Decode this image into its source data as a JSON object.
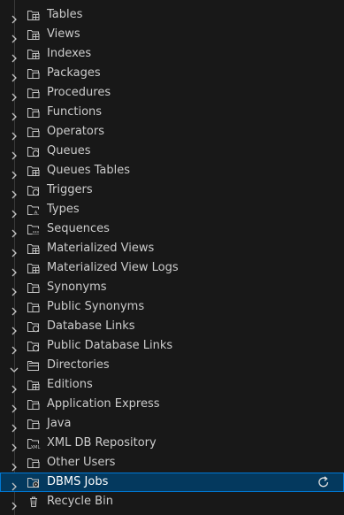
{
  "tree": {
    "items": [
      {
        "label": "Tables",
        "icon": "folder-tables-icon",
        "state": "collapsed"
      },
      {
        "label": "Views",
        "icon": "folder-views-icon",
        "state": "collapsed"
      },
      {
        "label": "Indexes",
        "icon": "folder-indexes-icon",
        "state": "collapsed"
      },
      {
        "label": "Packages",
        "icon": "folder-packages-icon",
        "state": "collapsed"
      },
      {
        "label": "Procedures",
        "icon": "folder-procedures-icon",
        "state": "collapsed"
      },
      {
        "label": "Functions",
        "icon": "folder-functions-icon",
        "state": "collapsed"
      },
      {
        "label": "Operators",
        "icon": "folder-operators-icon",
        "state": "collapsed"
      },
      {
        "label": "Queues",
        "icon": "folder-queues-icon",
        "state": "collapsed"
      },
      {
        "label": "Queues Tables",
        "icon": "folder-queues-tables-icon",
        "state": "collapsed"
      },
      {
        "label": "Triggers",
        "icon": "folder-triggers-icon",
        "state": "collapsed"
      },
      {
        "label": "Types",
        "icon": "folder-types-icon",
        "state": "collapsed"
      },
      {
        "label": "Sequences",
        "icon": "folder-sequences-icon",
        "state": "collapsed"
      },
      {
        "label": "Materialized Views",
        "icon": "folder-materialized-views-icon",
        "state": "collapsed"
      },
      {
        "label": "Materialized View Logs",
        "icon": "folder-materialized-view-logs-icon",
        "state": "collapsed"
      },
      {
        "label": "Synonyms",
        "icon": "folder-synonyms-icon",
        "state": "collapsed"
      },
      {
        "label": "Public Synonyms",
        "icon": "folder-public-synonyms-icon",
        "state": "collapsed"
      },
      {
        "label": "Database Links",
        "icon": "folder-database-links-icon",
        "state": "collapsed"
      },
      {
        "label": "Public Database Links",
        "icon": "folder-public-database-links-icon",
        "state": "collapsed"
      },
      {
        "label": "Directories",
        "icon": "folder-directories-icon",
        "state": "expanded"
      },
      {
        "label": "Editions",
        "icon": "folder-editions-icon",
        "state": "collapsed"
      },
      {
        "label": "Application Express",
        "icon": "folder-application-express-icon",
        "state": "collapsed"
      },
      {
        "label": "Java",
        "icon": "folder-java-icon",
        "state": "collapsed"
      },
      {
        "label": "XML DB Repository",
        "icon": "folder-xml-db-repository-icon",
        "state": "collapsed"
      },
      {
        "label": "Other Users",
        "icon": "folder-other-users-icon",
        "state": "collapsed"
      },
      {
        "label": "DBMS Jobs",
        "icon": "folder-dbms-jobs-icon",
        "state": "collapsed",
        "selected": true,
        "action": "refresh-icon"
      },
      {
        "label": "Recycle Bin",
        "icon": "trash-icon",
        "state": "collapsed"
      }
    ]
  },
  "colors": {
    "background": "#181818",
    "text": "#cccccc",
    "selected_background": "#04395e",
    "selected_border": "#0078d4",
    "icon": "#c5c5c5"
  }
}
